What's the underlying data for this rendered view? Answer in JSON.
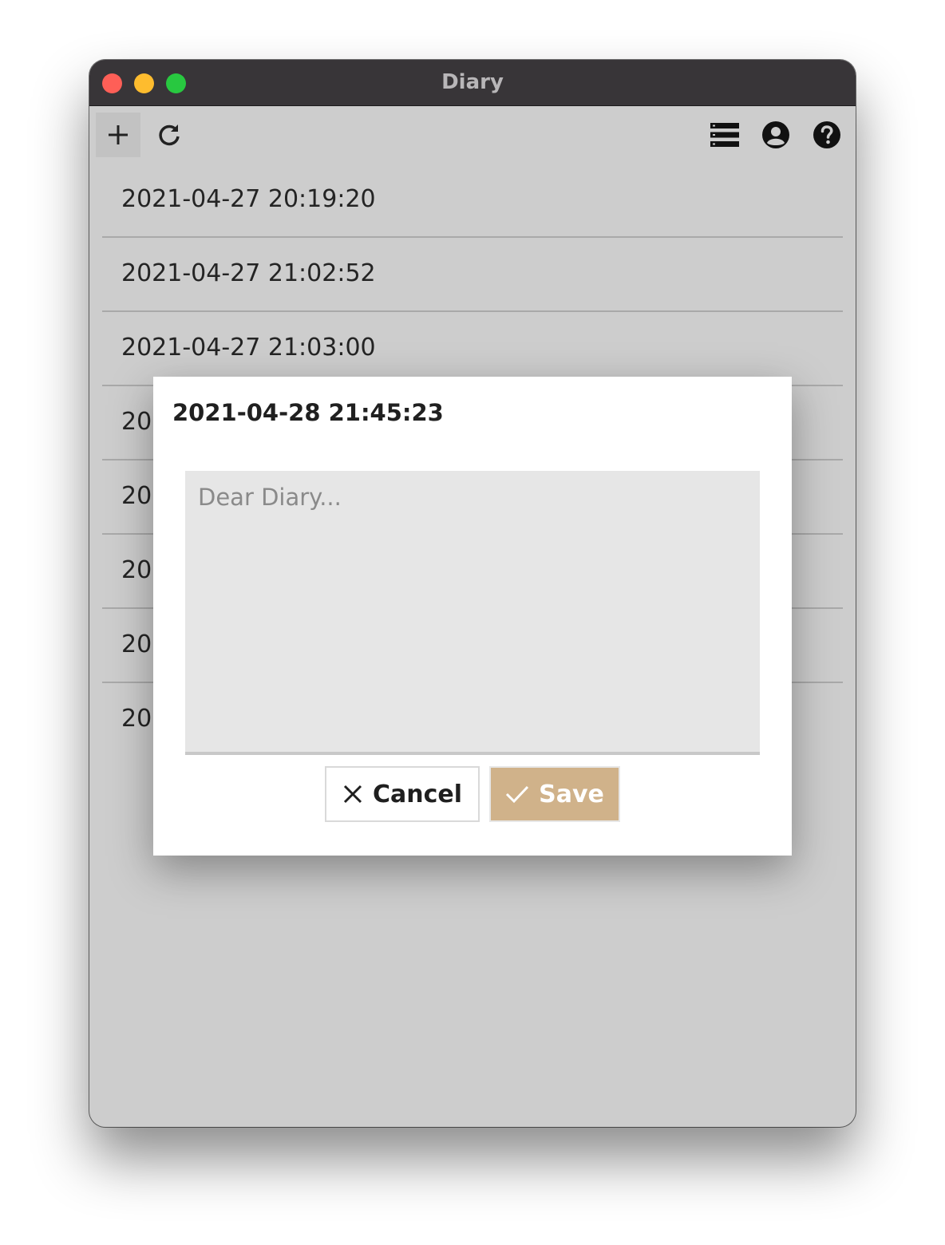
{
  "window": {
    "title": "Diary",
    "traffic_colors": {
      "close": "#fe5f57",
      "minimize": "#febc2e",
      "maximize": "#28c840"
    }
  },
  "toolbar": {
    "left": [
      "add-icon",
      "refresh-icon"
    ],
    "right": [
      "list-icon",
      "account-icon",
      "help-icon"
    ]
  },
  "entries": [
    {
      "label": "2021-04-27 20:19:20"
    },
    {
      "label": "2021-04-27 21:02:52"
    },
    {
      "label": "2021-04-27 21:03:00"
    },
    {
      "label": "202"
    },
    {
      "label": "202"
    },
    {
      "label": "202"
    },
    {
      "label": "202"
    },
    {
      "label": "202"
    }
  ],
  "dialog": {
    "title": "2021-04-28 21:45:23",
    "entry_value": "",
    "entry_placeholder": "Dear Diary...",
    "cancel_label": "Cancel",
    "save_label": "Save",
    "save_color": "#d0b28a"
  }
}
